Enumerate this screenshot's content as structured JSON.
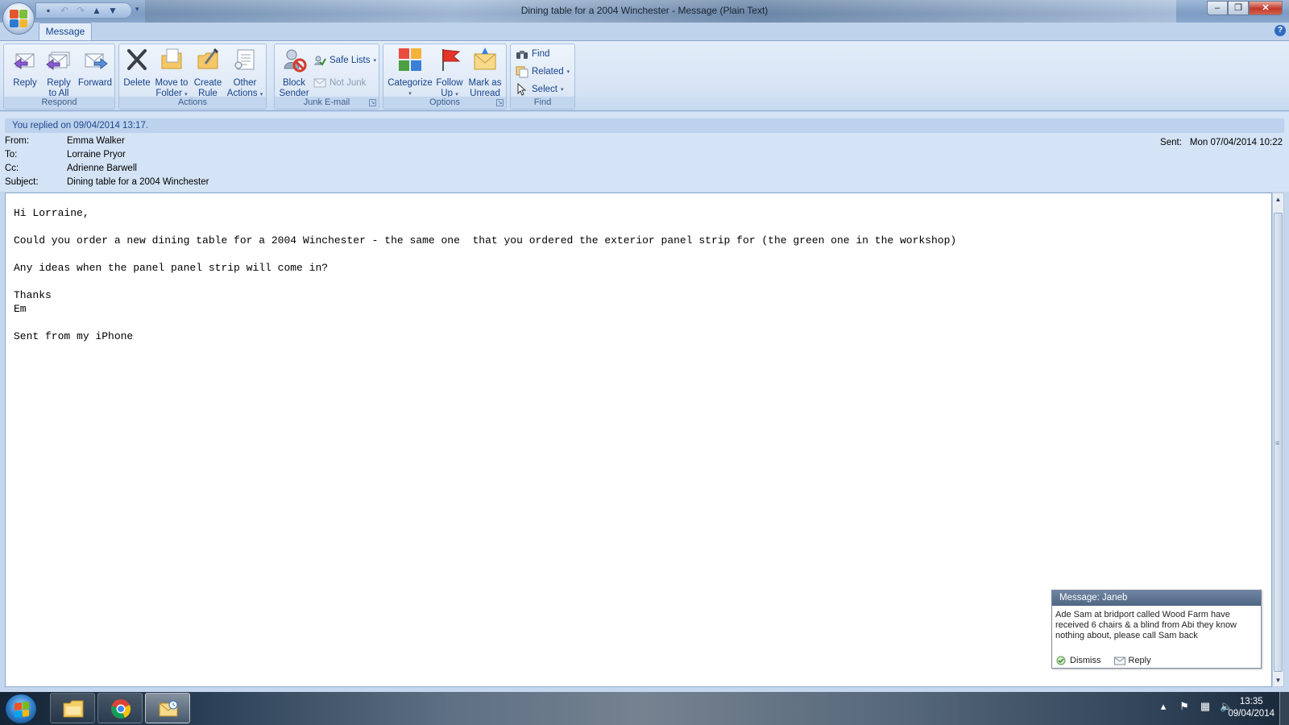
{
  "window": {
    "title": "Dining table for a 2004 Winchester - Message (Plain Text)",
    "controls": {
      "minimize": "–",
      "restore": "❐",
      "close": "✕"
    }
  },
  "quick_access": {
    "icons": [
      "save-icon",
      "undo-icon",
      "redo-icon",
      "previous-item-icon",
      "next-item-icon",
      "customize-icon"
    ]
  },
  "tabs": [
    {
      "label": "Message",
      "active": true
    }
  ],
  "ribbon": {
    "respond": {
      "label": "Respond",
      "reply": {
        "line1": "Reply",
        "line2": ""
      },
      "reply_all": {
        "line1": "Reply",
        "line2": "to All"
      },
      "forward": {
        "line1": "Forward",
        "line2": ""
      }
    },
    "actions": {
      "label": "Actions",
      "delete": {
        "line1": "Delete",
        "line2": ""
      },
      "move_to_folder": {
        "line1": "Move to",
        "line2": "Folder"
      },
      "create_rule": {
        "line1": "Create",
        "line2": "Rule"
      },
      "other_actions": {
        "line1": "Other",
        "line2": "Actions"
      }
    },
    "junk": {
      "label": "Junk E-mail",
      "block_sender": {
        "line1": "Block",
        "line2": "Sender"
      },
      "safe_lists": "Safe Lists",
      "not_junk": "Not Junk"
    },
    "options": {
      "label": "Options",
      "categorize": {
        "line1": "Categorize",
        "line2": ""
      },
      "follow_up": {
        "line1": "Follow",
        "line2": "Up"
      },
      "mark_unread": {
        "line1": "Mark as",
        "line2": "Unread"
      }
    },
    "find": {
      "label": "Find",
      "find": "Find",
      "related": "Related",
      "select": "Select"
    }
  },
  "info_bar": "You replied on 09/04/2014 13:17.",
  "header": {
    "from_label": "From:",
    "from": "Emma Walker",
    "to_label": "To:",
    "to": "Lorraine Pryor",
    "cc_label": "Cc:",
    "cc": "Adrienne Barwell",
    "subject_label": "Subject:",
    "subject": "Dining table for a 2004 Winchester",
    "sent_label": "Sent:",
    "sent": "Mon 07/04/2014 10:22"
  },
  "body_text": "Hi Lorraine,\n\nCould you order a new dining table for a 2004 Winchester - the same one  that you ordered the exterior panel strip for (the green one in the workshop)\n\nAny ideas when the panel panel strip will come in?\n\nThanks\nEm\n\nSent from my iPhone",
  "notification": {
    "title": "Message: Janeb",
    "text": "Ade  Sam at bridport called  Wood Farm have received 6 chairs & a blind from Abi they know nothing about, please call Sam back",
    "dismiss": "Dismiss",
    "reply": "Reply"
  },
  "taskbar": {
    "apps": [
      "file-explorer-icon",
      "chrome-icon",
      "outlook-icon"
    ],
    "tray_icons": [
      "show-hidden-icons",
      "action-center-flag-icon",
      "network-icon",
      "volume-icon"
    ],
    "time": "13:35",
    "date": "09/04/2014"
  },
  "colors": {
    "ribbon_bg": "#dde8f6",
    "accent": "#15428b",
    "title_bar": "#7d9cc4"
  }
}
